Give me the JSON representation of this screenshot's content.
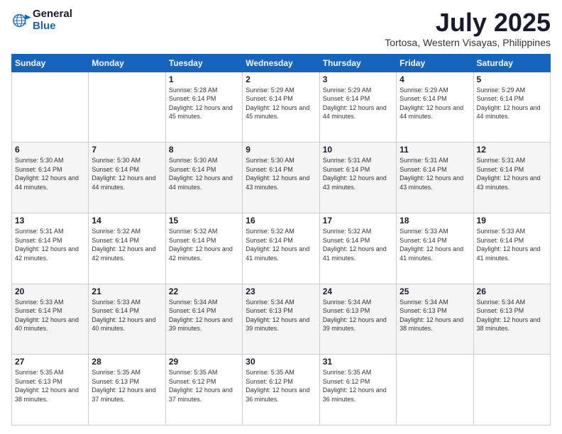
{
  "header": {
    "logo_line1": "General",
    "logo_line2": "Blue",
    "title": "July 2025",
    "subtitle": "Tortosa, Western Visayas, Philippines"
  },
  "days_of_week": [
    "Sunday",
    "Monday",
    "Tuesday",
    "Wednesday",
    "Thursday",
    "Friday",
    "Saturday"
  ],
  "weeks": [
    [
      {
        "day": "",
        "info": ""
      },
      {
        "day": "",
        "info": ""
      },
      {
        "day": "1",
        "info": "Sunrise: 5:28 AM\nSunset: 6:14 PM\nDaylight: 12 hours and 45 minutes."
      },
      {
        "day": "2",
        "info": "Sunrise: 5:29 AM\nSunset: 6:14 PM\nDaylight: 12 hours and 45 minutes."
      },
      {
        "day": "3",
        "info": "Sunrise: 5:29 AM\nSunset: 6:14 PM\nDaylight: 12 hours and 44 minutes."
      },
      {
        "day": "4",
        "info": "Sunrise: 5:29 AM\nSunset: 6:14 PM\nDaylight: 12 hours and 44 minutes."
      },
      {
        "day": "5",
        "info": "Sunrise: 5:29 AM\nSunset: 6:14 PM\nDaylight: 12 hours and 44 minutes."
      }
    ],
    [
      {
        "day": "6",
        "info": "Sunrise: 5:30 AM\nSunset: 6:14 PM\nDaylight: 12 hours and 44 minutes."
      },
      {
        "day": "7",
        "info": "Sunrise: 5:30 AM\nSunset: 6:14 PM\nDaylight: 12 hours and 44 minutes."
      },
      {
        "day": "8",
        "info": "Sunrise: 5:30 AM\nSunset: 6:14 PM\nDaylight: 12 hours and 44 minutes."
      },
      {
        "day": "9",
        "info": "Sunrise: 5:30 AM\nSunset: 6:14 PM\nDaylight: 12 hours and 43 minutes."
      },
      {
        "day": "10",
        "info": "Sunrise: 5:31 AM\nSunset: 6:14 PM\nDaylight: 12 hours and 43 minutes."
      },
      {
        "day": "11",
        "info": "Sunrise: 5:31 AM\nSunset: 6:14 PM\nDaylight: 12 hours and 43 minutes."
      },
      {
        "day": "12",
        "info": "Sunrise: 5:31 AM\nSunset: 6:14 PM\nDaylight: 12 hours and 43 minutes."
      }
    ],
    [
      {
        "day": "13",
        "info": "Sunrise: 5:31 AM\nSunset: 6:14 PM\nDaylight: 12 hours and 42 minutes."
      },
      {
        "day": "14",
        "info": "Sunrise: 5:32 AM\nSunset: 6:14 PM\nDaylight: 12 hours and 42 minutes."
      },
      {
        "day": "15",
        "info": "Sunrise: 5:32 AM\nSunset: 6:14 PM\nDaylight: 12 hours and 42 minutes."
      },
      {
        "day": "16",
        "info": "Sunrise: 5:32 AM\nSunset: 6:14 PM\nDaylight: 12 hours and 41 minutes."
      },
      {
        "day": "17",
        "info": "Sunrise: 5:32 AM\nSunset: 6:14 PM\nDaylight: 12 hours and 41 minutes."
      },
      {
        "day": "18",
        "info": "Sunrise: 5:33 AM\nSunset: 6:14 PM\nDaylight: 12 hours and 41 minutes."
      },
      {
        "day": "19",
        "info": "Sunrise: 5:33 AM\nSunset: 6:14 PM\nDaylight: 12 hours and 41 minutes."
      }
    ],
    [
      {
        "day": "20",
        "info": "Sunrise: 5:33 AM\nSunset: 6:14 PM\nDaylight: 12 hours and 40 minutes."
      },
      {
        "day": "21",
        "info": "Sunrise: 5:33 AM\nSunset: 6:14 PM\nDaylight: 12 hours and 40 minutes."
      },
      {
        "day": "22",
        "info": "Sunrise: 5:34 AM\nSunset: 6:14 PM\nDaylight: 12 hours and 39 minutes."
      },
      {
        "day": "23",
        "info": "Sunrise: 5:34 AM\nSunset: 6:13 PM\nDaylight: 12 hours and 39 minutes."
      },
      {
        "day": "24",
        "info": "Sunrise: 5:34 AM\nSunset: 6:13 PM\nDaylight: 12 hours and 39 minutes."
      },
      {
        "day": "25",
        "info": "Sunrise: 5:34 AM\nSunset: 6:13 PM\nDaylight: 12 hours and 38 minutes."
      },
      {
        "day": "26",
        "info": "Sunrise: 5:34 AM\nSunset: 6:13 PM\nDaylight: 12 hours and 38 minutes."
      }
    ],
    [
      {
        "day": "27",
        "info": "Sunrise: 5:35 AM\nSunset: 6:13 PM\nDaylight: 12 hours and 38 minutes."
      },
      {
        "day": "28",
        "info": "Sunrise: 5:35 AM\nSunset: 6:13 PM\nDaylight: 12 hours and 37 minutes."
      },
      {
        "day": "29",
        "info": "Sunrise: 5:35 AM\nSunset: 6:12 PM\nDaylight: 12 hours and 37 minutes."
      },
      {
        "day": "30",
        "info": "Sunrise: 5:35 AM\nSunset: 6:12 PM\nDaylight: 12 hours and 36 minutes."
      },
      {
        "day": "31",
        "info": "Sunrise: 5:35 AM\nSunset: 6:12 PM\nDaylight: 12 hours and 36 minutes."
      },
      {
        "day": "",
        "info": ""
      },
      {
        "day": "",
        "info": ""
      }
    ]
  ],
  "colors": {
    "header_bg": "#1565c0",
    "header_text": "#ffffff",
    "row_even": "#f5f5f5",
    "row_odd": "#ffffff"
  }
}
